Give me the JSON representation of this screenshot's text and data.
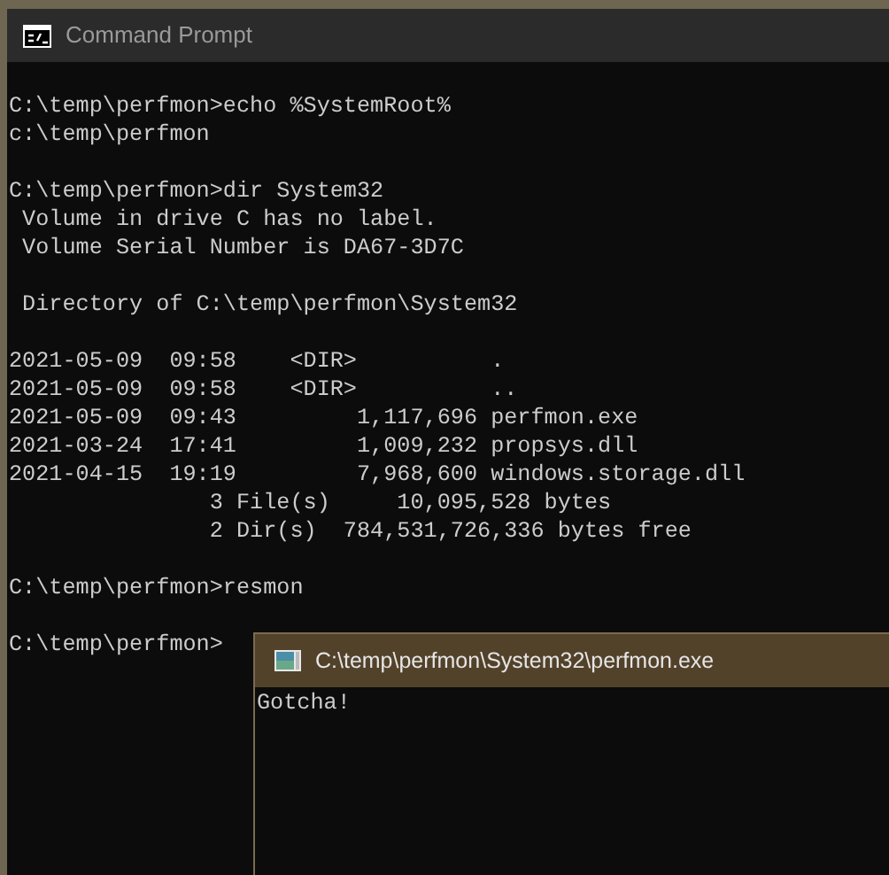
{
  "window": {
    "title": "Command Prompt"
  },
  "console_blocks": [
    [
      "C:\\temp\\perfmon>echo %SystemRoot%",
      "c:\\temp\\perfmon"
    ],
    [
      "C:\\temp\\perfmon>dir System32",
      " Volume in drive C has no label.",
      " Volume Serial Number is DA67-3D7C"
    ],
    [
      " Directory of C:\\temp\\perfmon\\System32"
    ],
    [
      "2021-05-09  09:58    <DIR>          .",
      "2021-05-09  09:58    <DIR>          ..",
      "2021-05-09  09:43         1,117,696 perfmon.exe",
      "2021-03-24  17:41         1,009,232 propsys.dll",
      "2021-04-15  19:19         7,968,600 windows.storage.dll",
      "               3 File(s)     10,095,528 bytes",
      "               2 Dir(s)  784,531,726,336 bytes free"
    ],
    [
      "C:\\temp\\perfmon>resmon"
    ],
    [
      "C:\\temp\\perfmon>"
    ]
  ],
  "popup": {
    "title": "C:\\temp\\perfmon\\System32\\perfmon.exe",
    "lines": [
      "Gotcha!"
    ]
  }
}
